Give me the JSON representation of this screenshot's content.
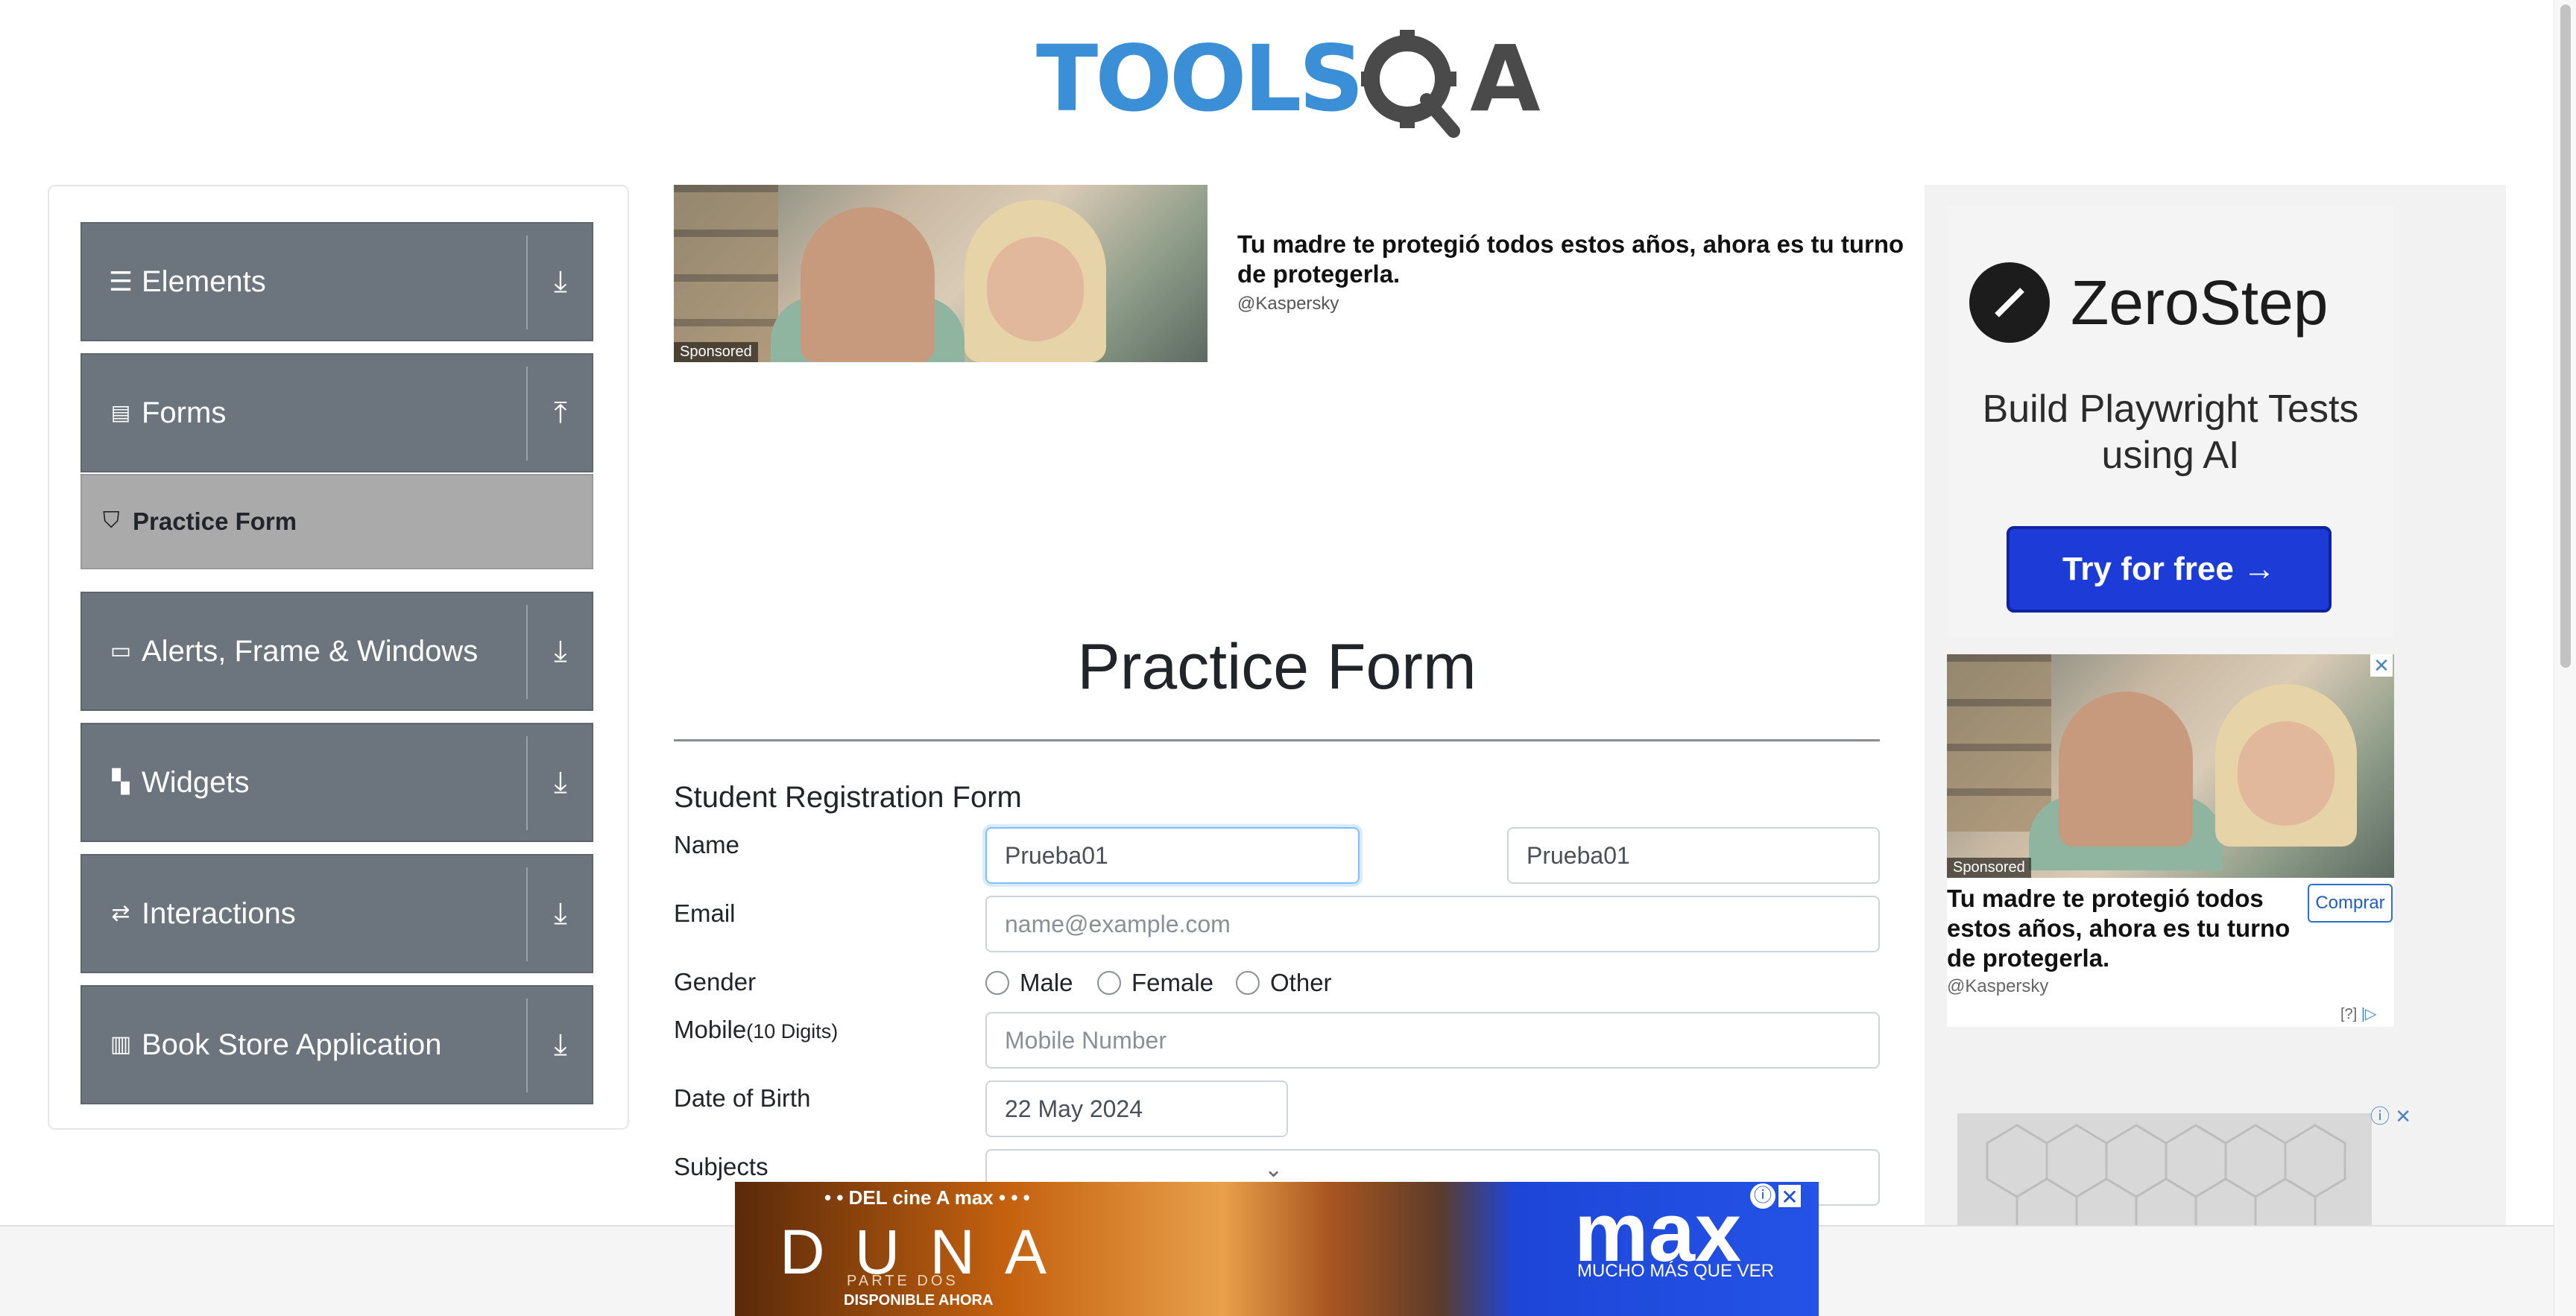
{
  "header": {
    "logo_tools": "TOOLS",
    "logo_qa": "QA"
  },
  "sidebar": {
    "groups": [
      {
        "label": "Elements",
        "icon": "list-icon",
        "arrow": "download-arrow"
      },
      {
        "label": "Forms",
        "icon": "document-icon",
        "arrow": "upload-arrow"
      },
      {
        "label": "Alerts, Frame & Windows",
        "icon": "window-icon",
        "arrow": "download-arrow"
      },
      {
        "label": "Widgets",
        "icon": "widgets-icon",
        "arrow": "download-arrow"
      },
      {
        "label": "Interactions",
        "icon": "interactions-icon",
        "arrow": "download-arrow"
      },
      {
        "label": "Book Store Application",
        "icon": "books-icon",
        "arrow": "download-arrow"
      }
    ],
    "active_item": {
      "label": "Practice Form",
      "icon": "html5-icon"
    }
  },
  "top_ad": {
    "sponsored": "Sponsored",
    "title": "Tu madre te protegió todos estos años, ahora es tu turno de protegerla.",
    "brand": "@Kaspersky"
  },
  "page": {
    "title": "Practice Form",
    "form_heading": "Student Registration Form"
  },
  "form": {
    "name_label": "Name",
    "first_name_value": "Prueba01",
    "last_name_value": "Prueba01",
    "email_label": "Email",
    "email_placeholder": "name@example.com",
    "gender_label": "Gender",
    "gender_options": [
      "Male",
      "Female",
      "Other"
    ],
    "mobile_label": "Mobile",
    "mobile_hint": "(10 Digits)",
    "mobile_placeholder": "Mobile Number",
    "dob_label": "Date of Birth",
    "dob_value": "22 May 2024",
    "subjects_label": "Subjects"
  },
  "right_ads": {
    "zerostep_name": "ZeroStep",
    "zerostep_tagline": "Build Playwright Tests using AI",
    "zerostep_button": "Try for free →",
    "ad2_sponsored": "Sponsored",
    "ad2_title": "Tu madre te protegió todos estos años, ahora es tu turno de protegerla.",
    "ad2_brand": "@Kaspersky",
    "ad2_buy": "Comprar",
    "ad2_info": "[?]"
  },
  "bottom_ad": {
    "small": "• • DEL cine A max • • •",
    "title": "DUNA",
    "subtitle": "PARTE DOS",
    "available": "DISPONIBLE AHORA",
    "brand": "max",
    "brand_tagline": "MUCHO MÁS QUE VER"
  },
  "colors": {
    "accent_blue": "#3a8fd6",
    "sidebar_gray": "#6c757d",
    "active_gray": "#aaaaaa",
    "zerostep_blue": "#1d3bd6"
  }
}
